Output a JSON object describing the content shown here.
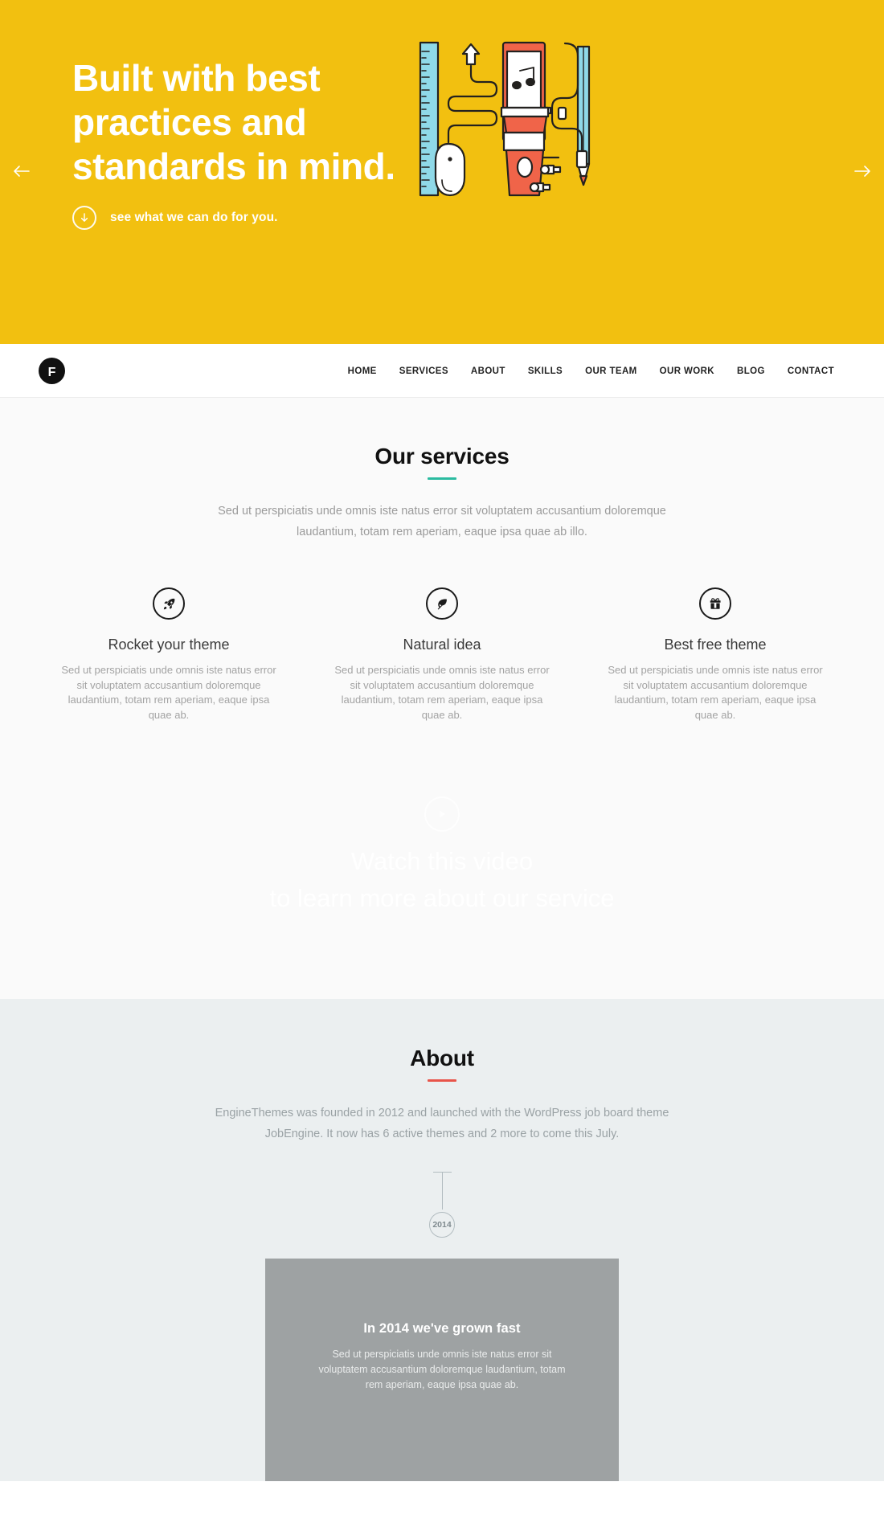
{
  "hero": {
    "title": "Built with best practices and standards in mind.",
    "cta_label": "see what we can do for you.",
    "prev_icon": "arrow-left-icon",
    "next_icon": "arrow-right-icon",
    "down_icon": "arrow-down-icon",
    "bg_color": "#f2c010",
    "illustration": "desk-tools-illustration"
  },
  "navbar": {
    "logo_letter": "F",
    "items": [
      {
        "label": "HOME"
      },
      {
        "label": "SERVICES"
      },
      {
        "label": "ABOUT"
      },
      {
        "label": "SKILLS"
      },
      {
        "label": "OUR TEAM"
      },
      {
        "label": "OUR WORK"
      },
      {
        "label": "BLOG"
      },
      {
        "label": "CONTACT"
      }
    ]
  },
  "services": {
    "title": "Our services",
    "rule_color": "#2bbba0",
    "subtitle": "Sed ut perspiciatis unde omnis iste natus error sit voluptatem accusantium doloremque laudantium, totam rem aperiam, eaque ipsa quae ab illo.",
    "cards": [
      {
        "icon": "rocket-icon",
        "title": "Rocket your theme",
        "desc": "Sed ut perspiciatis unde omnis iste natus error sit voluptatem accusantium doloremque laudantium, totam rem aperiam, eaque ipsa quae ab."
      },
      {
        "icon": "leaf-icon",
        "title": "Natural idea",
        "desc": "Sed ut perspiciatis unde omnis iste natus error sit voluptatem accusantium doloremque laudantium, totam rem aperiam, eaque ipsa quae ab."
      },
      {
        "icon": "gift-icon",
        "title": "Best free theme",
        "desc": "Sed ut perspiciatis unde omnis iste natus error sit voluptatem accusantium doloremque laudantium, totam rem aperiam, eaque ipsa quae ab."
      }
    ]
  },
  "video": {
    "play_icon": "play-circle-icon",
    "line1": "Watch this video",
    "line2": "to learn more about our service"
  },
  "about": {
    "title": "About",
    "rule_color": "#e8544a",
    "subtitle": "EngineThemes was founded in 2012 and launched with the WordPress job board theme JobEngine. It now has 6 active themes and 2 more to come this July.",
    "timeline": {
      "year": "2014",
      "card_title": "In 2014 we've grown fast",
      "card_desc": "Sed ut perspiciatis unde omnis iste natus error sit voluptatem accusantium doloremque laudantium, totam rem aperiam, eaque ipsa quae ab.",
      "card_bg": "#9ea2a3"
    }
  }
}
